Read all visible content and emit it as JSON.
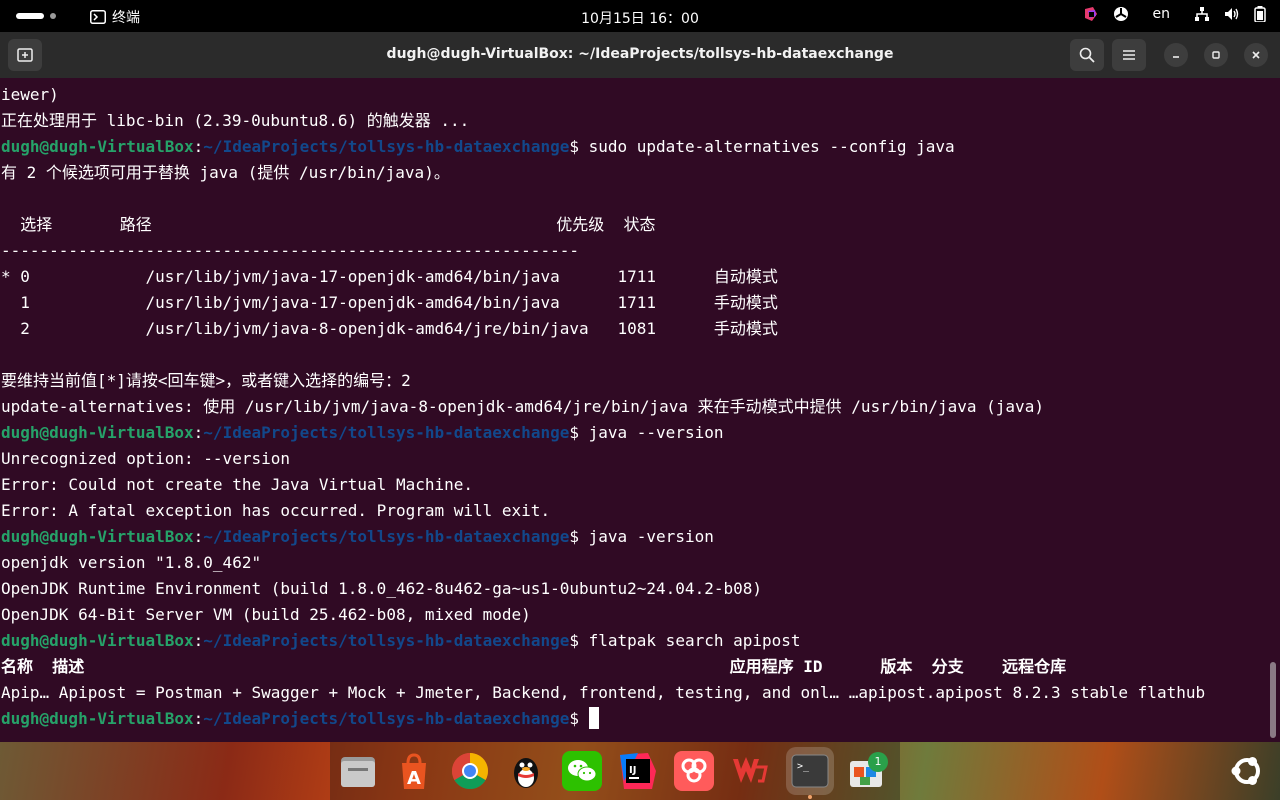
{
  "topbar": {
    "app_name": "终端",
    "clock": "10月15日  16：00",
    "language": "en"
  },
  "window": {
    "title": "dugh@dugh-VirtualBox: ~/IdeaProjects/tollsys-hb-dataexchange"
  },
  "prompt": {
    "user_host": "dugh@dugh-VirtualBox",
    "sep": ":",
    "path": "~/IdeaProjects/tollsys-hb-dataexchange",
    "symbol": "$"
  },
  "terminal_lines": [
    {
      "type": "out",
      "text": "iewer)"
    },
    {
      "type": "out",
      "text": "正在处理用于 libc-bin (2.39-0ubuntu8.6) 的触发器 ..."
    },
    {
      "type": "cmd",
      "text": " sudo update-alternatives --config java"
    },
    {
      "type": "out",
      "text": "有 2 个候选项可用于替换 java (提供 /usr/bin/java)。"
    },
    {
      "type": "out",
      "text": ""
    },
    {
      "type": "out",
      "text": "  选择       路径                                          优先级  状态"
    },
    {
      "type": "out",
      "text": "------------------------------------------------------------"
    },
    {
      "type": "out",
      "text": "* 0            /usr/lib/jvm/java-17-openjdk-amd64/bin/java      1711      自动模式"
    },
    {
      "type": "out",
      "text": "  1            /usr/lib/jvm/java-17-openjdk-amd64/bin/java      1711      手动模式"
    },
    {
      "type": "out",
      "text": "  2            /usr/lib/jvm/java-8-openjdk-amd64/jre/bin/java   1081      手动模式"
    },
    {
      "type": "out",
      "text": ""
    },
    {
      "type": "out",
      "text": "要维持当前值[*]请按<回车键>，或者键入选择的编号：2"
    },
    {
      "type": "out",
      "text": "update-alternatives: 使用 /usr/lib/jvm/java-8-openjdk-amd64/jre/bin/java 来在手动模式中提供 /usr/bin/java (java)"
    },
    {
      "type": "cmd",
      "text": " java --version"
    },
    {
      "type": "out",
      "text": "Unrecognized option: --version"
    },
    {
      "type": "out",
      "text": "Error: Could not create the Java Virtual Machine."
    },
    {
      "type": "out",
      "text": "Error: A fatal exception has occurred. Program will exit."
    },
    {
      "type": "cmd",
      "text": " java -version"
    },
    {
      "type": "out",
      "text": "openjdk version \"1.8.0_462\""
    },
    {
      "type": "out",
      "text": "OpenJDK Runtime Environment (build 1.8.0_462-8u462-ga~us1-0ubuntu2~24.04.2-b08)"
    },
    {
      "type": "out",
      "text": "OpenJDK 64-Bit Server VM (build 25.462-b08, mixed mode)"
    },
    {
      "type": "cmd",
      "text": " flatpak search apipost"
    },
    {
      "type": "hdr",
      "text": "名称  描述                                                                   应用程序 ID      版本  分支    远程仓库"
    },
    {
      "type": "out",
      "text": "Apip… Apipost = Postman + Swagger + Mock + Jmeter, Backend, frontend, testing, and onl… …apipost.apipost 8.2.3 stable flathub"
    },
    {
      "type": "prompt",
      "text": " "
    }
  ],
  "dock": {
    "icons": [
      "files",
      "app-center",
      "chrome",
      "qq",
      "wechat",
      "intellij-idea",
      "apipost",
      "wps-office",
      "terminal",
      "software-updater"
    ],
    "updater_badge": "1"
  },
  "colors": {
    "terminal_bg": "#300a24",
    "prompt_user": "#26a269",
    "prompt_path": "#12488b",
    "header_bg": "#2b2b2b"
  }
}
